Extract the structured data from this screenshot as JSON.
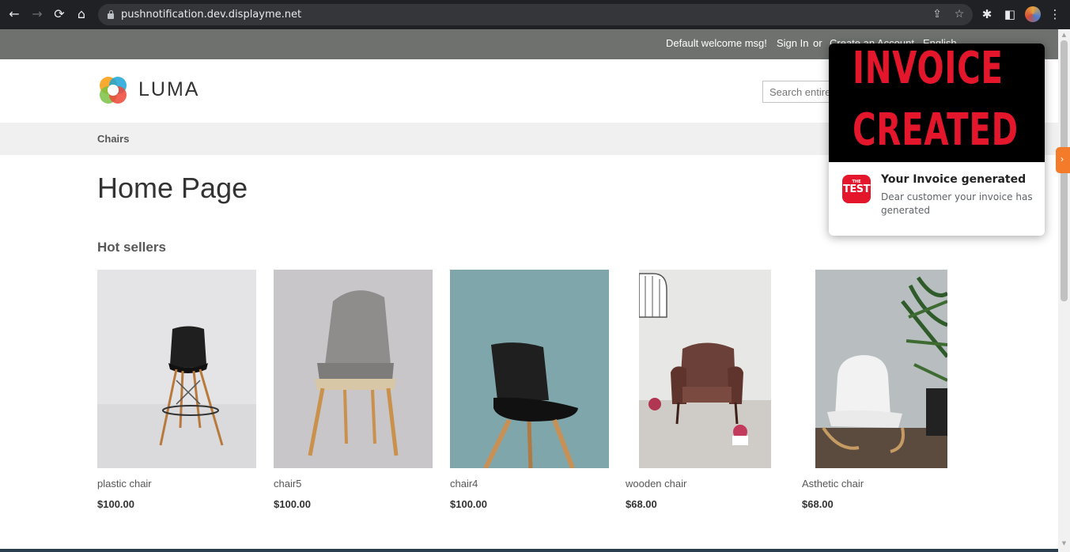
{
  "browser": {
    "url": "pushnotification.dev.displayme.net",
    "back_icon": "←",
    "forward_icon": "→",
    "reload_icon": "⟳",
    "home_icon": "⌂",
    "share_icon": "⇪",
    "star_icon": "☆",
    "extensions_icon": "✱",
    "sidepanel_icon": "◧",
    "menu_icon": "⋮"
  },
  "panel_header": {
    "welcome": "Default welcome msg!",
    "sign_in": "Sign In",
    "or": "or",
    "create_account": "Create an Account",
    "language": "English ⌄"
  },
  "header": {
    "logo_text": "LUMA",
    "search_placeholder": "Search entire store here..."
  },
  "nav": {
    "items": [
      {
        "label": "Chairs"
      }
    ]
  },
  "main": {
    "page_title": "Home Page",
    "section_title": "Hot sellers",
    "products": [
      {
        "name": "plastic chair",
        "price": "$100.00"
      },
      {
        "name": "chair5",
        "price": "$100.00"
      },
      {
        "name": "chair4",
        "price": "$100.00"
      },
      {
        "name": "wooden chair",
        "price": "$68.00"
      },
      {
        "name": "Asthetic chair",
        "price": "$68.00"
      }
    ]
  },
  "notification": {
    "banner_line1": "INVOICE",
    "banner_line2": "CREATED",
    "icon_small": "THE",
    "icon_large": "TEST",
    "title": "Your Invoice generated",
    "body": "Dear customer your invoice has generated"
  },
  "colors": {
    "panel_header_bg": "#6e716e",
    "accent_red": "#e3162b",
    "side_tab": "#f47b2a"
  }
}
